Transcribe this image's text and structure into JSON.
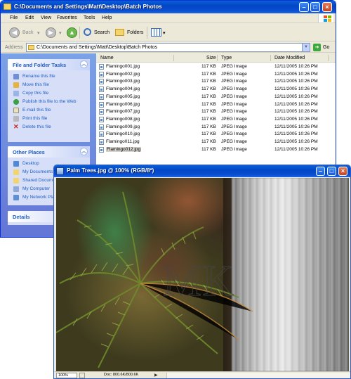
{
  "explorer": {
    "title": "C:\\Documents and Settings\\Matt\\Desktop\\Batch Photos",
    "menu": [
      "File",
      "Edit",
      "View",
      "Favorites",
      "Tools",
      "Help"
    ],
    "toolbar": {
      "back": "Back",
      "search": "Search",
      "folders": "Folders"
    },
    "address": {
      "label": "Address",
      "path": "C:\\Documents and Settings\\Matt\\Desktop\\Batch Photos",
      "go": "Go"
    },
    "tasks": {
      "header": "File and Folder Tasks",
      "items": [
        "Rename this file",
        "Move this file",
        "Copy this file",
        "Publish this file to the Web",
        "E-mail this file",
        "Print this file",
        "Delete this file"
      ]
    },
    "other_places": {
      "header": "Other Places",
      "items": [
        "Desktop",
        "My Documents",
        "Shared Documents",
        "My Computer",
        "My Network Places"
      ]
    },
    "details": {
      "header": "Details"
    },
    "columns": {
      "name": "Name",
      "size": "Size",
      "type": "Type",
      "modified": "Date Modified"
    },
    "files": [
      {
        "name": "Flamingo001.jpg",
        "size": "117 KB",
        "type": "JPEG Image",
        "modified": "12/11/2005 10:26 PM"
      },
      {
        "name": "Flamingo002.jpg",
        "size": "117 KB",
        "type": "JPEG Image",
        "modified": "12/11/2005 10:26 PM"
      },
      {
        "name": "Flamingo003.jpg",
        "size": "117 KB",
        "type": "JPEG Image",
        "modified": "12/11/2005 10:26 PM"
      },
      {
        "name": "Flamingo004.jpg",
        "size": "117 KB",
        "type": "JPEG Image",
        "modified": "12/11/2005 10:26 PM"
      },
      {
        "name": "Flamingo005.jpg",
        "size": "117 KB",
        "type": "JPEG Image",
        "modified": "12/11/2005 10:26 PM"
      },
      {
        "name": "Flamingo006.jpg",
        "size": "117 KB",
        "type": "JPEG Image",
        "modified": "12/11/2005 10:26 PM"
      },
      {
        "name": "Flamingo007.jpg",
        "size": "117 KB",
        "type": "JPEG Image",
        "modified": "12/11/2005 10:26 PM"
      },
      {
        "name": "Flamingo008.jpg",
        "size": "117 KB",
        "type": "JPEG Image",
        "modified": "12/11/2005 10:26 PM"
      },
      {
        "name": "Flamingo009.jpg",
        "size": "117 KB",
        "type": "JPEG Image",
        "modified": "12/11/2005 10:26 PM"
      },
      {
        "name": "Flamingo010.jpg",
        "size": "117 KB",
        "type": "JPEG Image",
        "modified": "12/11/2005 10:26 PM"
      },
      {
        "name": "Flamingo011.jpg",
        "size": "117 KB",
        "type": "JPEG Image",
        "modified": "12/11/2005 10:26 PM"
      },
      {
        "name": "Flamingo012.jpg",
        "size": "117 KB",
        "type": "JPEG Image",
        "modified": "12/11/2005 10:26 PM"
      }
    ]
  },
  "psdoc": {
    "title": "Palm Trees.jpg @ 100% (RGB/8*)",
    "watermark": "MK",
    "zoom": "100%",
    "doc_info": "Doc: 800.6K/800.6K"
  }
}
